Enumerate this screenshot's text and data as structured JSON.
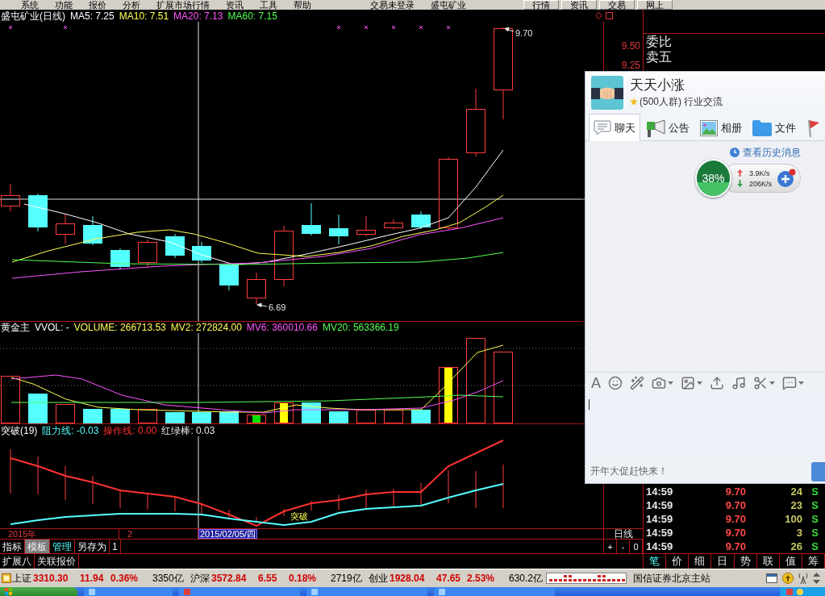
{
  "menu_bar": {
    "items": [
      "系统",
      "功能",
      "报价",
      "分析",
      "扩展市场行情",
      "资讯",
      "工具",
      "帮助"
    ],
    "login_status": "交易未登录",
    "stock_name": "盛屯矿业",
    "buttons": [
      "行情",
      "资讯",
      "交易",
      "网上"
    ]
  },
  "price_chart": {
    "title": "盛屯矿业(日线)",
    "indicators": [
      {
        "label": "MA5: 7.25",
        "color": "#ffffff"
      },
      {
        "label": "MA10: 7.51",
        "color": "#ffff54"
      },
      {
        "label": "MA20: 7.13",
        "color": "#ff54ff"
      },
      {
        "label": "MA60: 7.15",
        "color": "#54ff54"
      }
    ],
    "high_label": "9.70",
    "low_label": "6.69",
    "axis_labels": [
      "9.50",
      "9.25"
    ]
  },
  "volume_chart": {
    "title": "黄金主",
    "indicators": [
      {
        "label": "VVOL: -",
        "color": "#ffffff"
      },
      {
        "label": "VOLUME: 266713.53",
        "color": "#ffff54"
      },
      {
        "label": "MV2: 272824.00",
        "color": "#ffff54"
      },
      {
        "label": "MV6: 360010.66",
        "color": "#ff54ff"
      },
      {
        "label": "MV20: 563366.19",
        "color": "#54ff54"
      }
    ]
  },
  "signal_chart": {
    "title": "突破(19)",
    "indicators": [
      {
        "label": "阻力线: -0.03",
        "color": "#54ffff"
      },
      {
        "label": "操作线: 0.00",
        "color": "#ff3232"
      },
      {
        "label": "红绿棒: 0.03",
        "color": "#e6e6e6"
      }
    ],
    "signal_label": "突破"
  },
  "date_axis": {
    "labels": [
      "2015年",
      "2"
    ],
    "cursor_date": "2015/02/05/四",
    "period": "日线"
  },
  "bottom_tabs": [
    {
      "label": "指标",
      "selected": false,
      "highlighted": false
    },
    {
      "label": "模板",
      "selected": true,
      "highlighted": false
    },
    {
      "label": "管理",
      "selected": false,
      "highlighted": true
    },
    {
      "label": "另存为",
      "selected": false,
      "highlighted": false
    },
    {
      "label": "1",
      "selected": false,
      "highlighted": false
    }
  ],
  "zoom_buttons": [
    "+",
    "-",
    "0"
  ],
  "extra_tabs": [
    "扩展八",
    "关联报价"
  ],
  "quote_panel": {
    "labels": [
      "委比",
      "卖五"
    ],
    "trades": [
      {
        "time": "14:59",
        "price": "9.70",
        "volume": "24",
        "side": "S"
      },
      {
        "time": "14:59",
        "price": "9.70",
        "volume": "23",
        "side": "S"
      },
      {
        "time": "14:59",
        "price": "9.70",
        "volume": "100",
        "side": "S"
      },
      {
        "time": "14:59",
        "price": "9.70",
        "volume": "3",
        "side": "S"
      },
      {
        "time": "14:59",
        "price": "9.70",
        "volume": "26",
        "side": "S"
      }
    ],
    "tabs": [
      {
        "label": "笔",
        "selected": true
      },
      {
        "label": "价",
        "selected": false
      },
      {
        "label": "细",
        "selected": false
      },
      {
        "label": "日",
        "selected": false
      },
      {
        "label": "势",
        "selected": false
      },
      {
        "label": "联",
        "selected": false
      },
      {
        "label": "值",
        "selected": false
      },
      {
        "label": "筹",
        "selected": false
      }
    ]
  },
  "status_bar": {
    "indices": [
      {
        "name": "上证",
        "value": "3310.30",
        "change": "11.94",
        "percent": "0.36%",
        "amount": "3350亿"
      },
      {
        "name": "沪深",
        "value": "3572.84",
        "change": "6.55",
        "percent": "0.18%",
        "amount": "2719亿"
      },
      {
        "name": "创业",
        "value": "1928.04",
        "change": "47.65",
        "percent": "2.53%",
        "amount": "630.2亿"
      }
    ],
    "server": "国信证券北京主站"
  },
  "chat_window": {
    "title": "天天小涨",
    "subtitle": "(500人群) 行业交流",
    "tabs": [
      {
        "kind": "chat",
        "label": "聊天",
        "selected": true
      },
      {
        "kind": "notice",
        "label": "公告",
        "selected": false
      },
      {
        "kind": "album",
        "label": "相册",
        "selected": false
      },
      {
        "kind": "file",
        "label": "文件",
        "selected": false
      },
      {
        "kind": "flag",
        "selected": false
      }
    ],
    "history_link": "查看历史消息",
    "network": {
      "percent": "38%",
      "level": 0.38,
      "upload": "3.9K/s",
      "download": "206K/s"
    },
    "font_button": "A",
    "promo": "开年大促赶快来！"
  }
}
